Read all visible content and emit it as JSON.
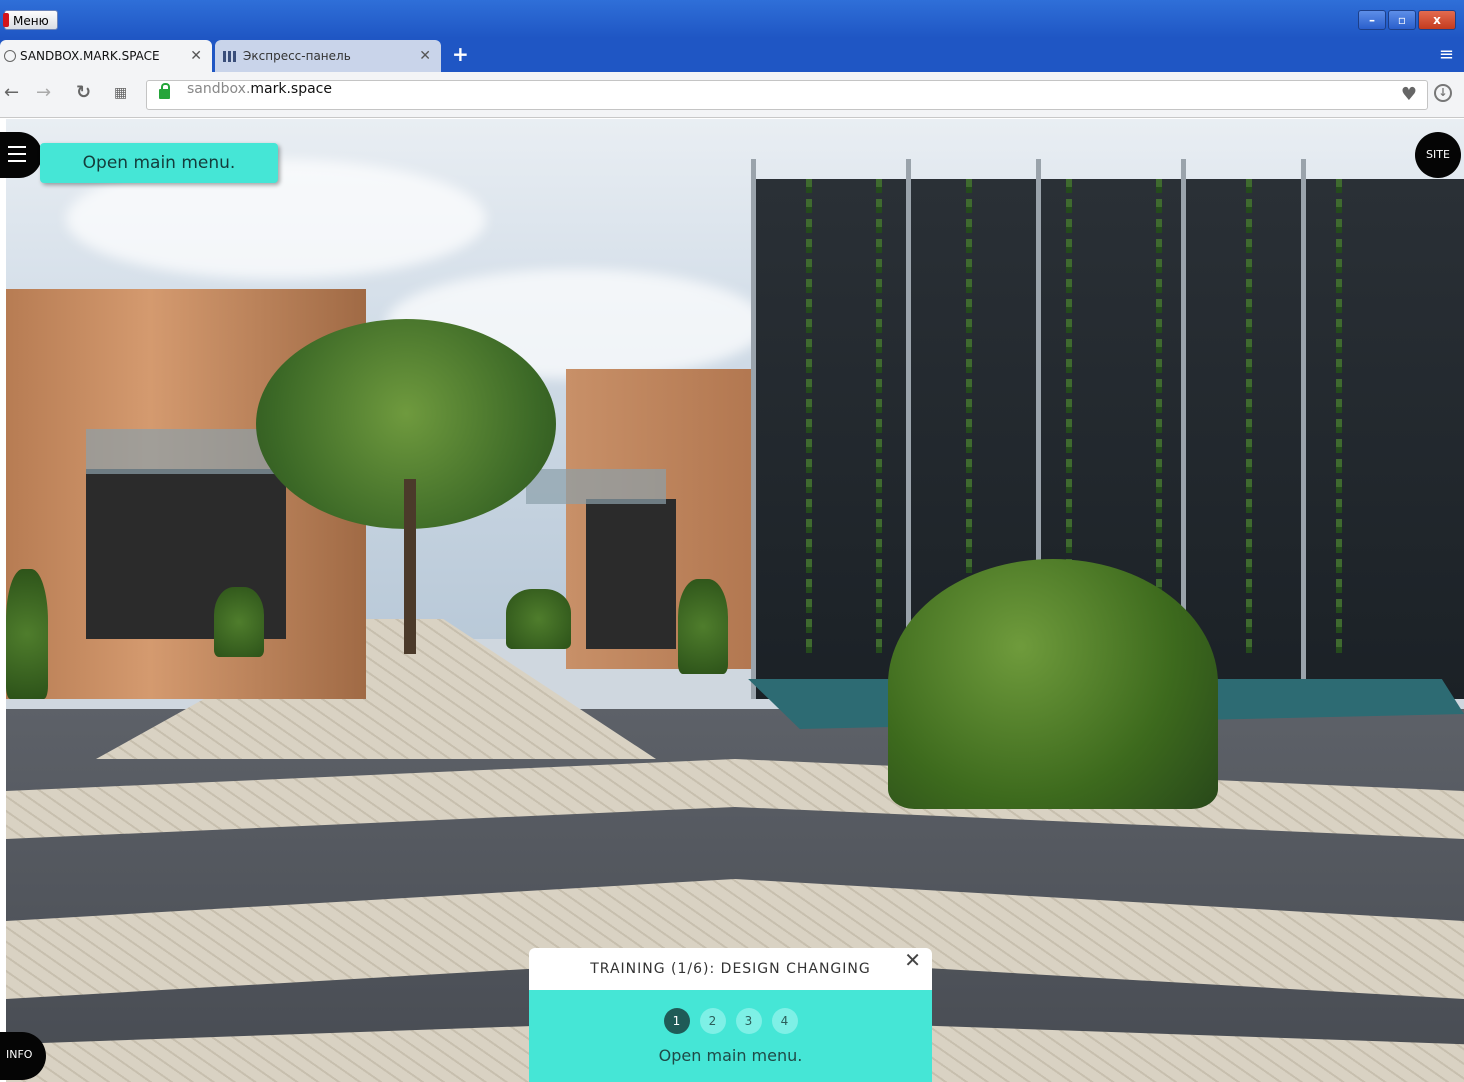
{
  "browser": {
    "menu_label": "Меню",
    "tabs": [
      {
        "label": "SANDBOX.MARK.SPACE",
        "active": true
      },
      {
        "label": "Экспресс-панель",
        "active": false
      }
    ],
    "new_tab_symbol": "+",
    "tab_close_symbol": "✕",
    "window_controls": [
      "minimize",
      "maximize",
      "close"
    ],
    "window_close_symbol": "x",
    "url_dim": "sandbox.",
    "url_host": "mark.space",
    "icons": [
      "back-icon",
      "forward-icon",
      "reload-icon",
      "speed-dial-icon",
      "lock-icon",
      "heart-icon",
      "download-icon"
    ]
  },
  "scene": {
    "menu_tooltip": "Open main menu.",
    "site_button": "SITE",
    "info_button": "INFO"
  },
  "training": {
    "title": "TRAINING (1/6): DESIGN CHANGING",
    "close_symbol": "✕",
    "steps": [
      "1",
      "2",
      "3",
      "4"
    ],
    "active_step": "1",
    "instruction": "Open main menu."
  },
  "colors": {
    "accent_teal": "#45e6d6",
    "dark_teal": "#1f5b57",
    "titlebar_blue": "#1f56c4"
  }
}
